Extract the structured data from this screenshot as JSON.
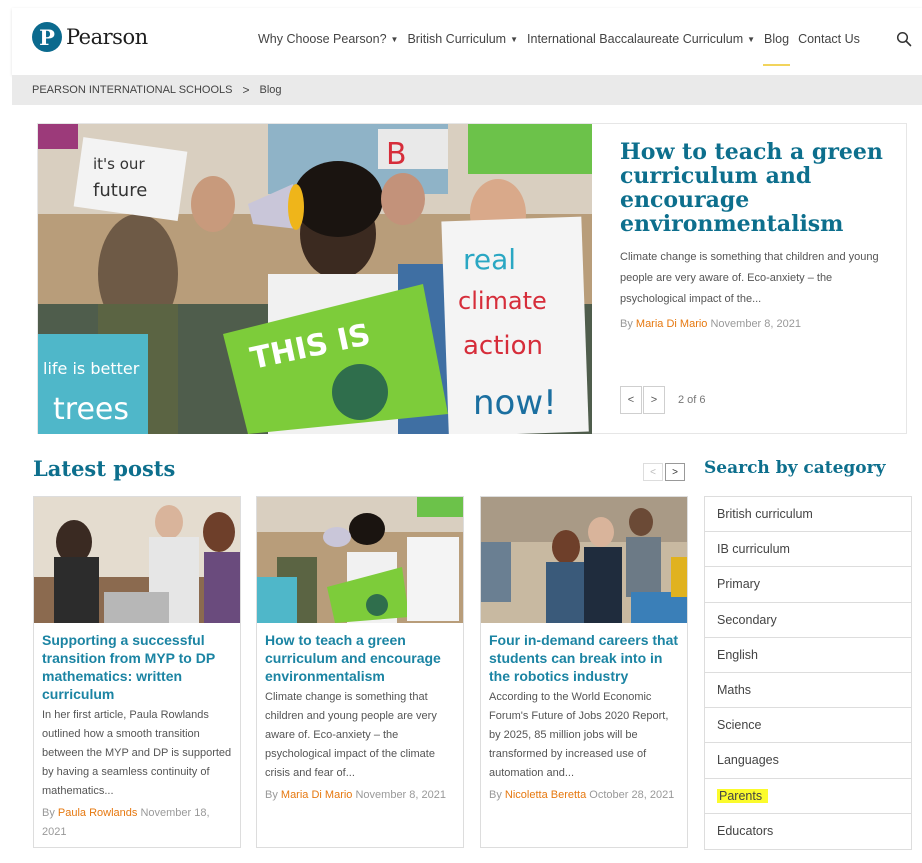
{
  "brand": {
    "logo_letter": "P",
    "name": "Pearson",
    "color": "#0b6a8e"
  },
  "nav": {
    "items": [
      {
        "label": "Why Choose Pearson?",
        "has_caret": true
      },
      {
        "label": "British Curriculum",
        "has_caret": true
      },
      {
        "label": "International Baccalaureate Curriculum",
        "has_caret": true
      },
      {
        "label": "Blog",
        "has_caret": false,
        "active": true
      },
      {
        "label": "Contact Us",
        "has_caret": false
      }
    ],
    "search_icon": "search-icon"
  },
  "breadcrumb": {
    "home": "PEARSON INTERNATIONAL SCHOOLS",
    "separator": ">",
    "current": "Blog"
  },
  "featured": {
    "title": "How to teach a green curriculum and encourage environmentalism",
    "excerpt": "Climate change is something that children and young people are very aware of. Eco-anxiety – the psychological impact of the...",
    "by": "By",
    "author": "Maria Di Mario",
    "date": "November 8, 2021",
    "pager": {
      "prev": "<",
      "next": ">",
      "count": "2 of 6"
    },
    "signs": {
      "s1": "real",
      "s2": "climate",
      "s3": "action",
      "s4": "now!",
      "s5": "THIS IS",
      "s6": "life is better",
      "s7": "trees",
      "s8": "it's our",
      "s9": "future",
      "s10": "B"
    }
  },
  "latest": {
    "heading": "Latest posts",
    "prev": "<",
    "next": ">",
    "posts": [
      {
        "title": "Supporting a successful transition from MYP to DP mathematics: written curriculum",
        "excerpt": "In her first article, Paula Rowlands outlined how a smooth transition between the MYP and DP is supported by having a seamless continuity of mathematics...",
        "by": "By",
        "author": "Paula Rowlands",
        "date": "November 18, 2021"
      },
      {
        "title": "How to teach a green curriculum and encourage environmentalism",
        "excerpt": "Climate change is something that children and young people are very aware of. Eco-anxiety – the psychological impact of the climate crisis and fear of...",
        "by": "By",
        "author": "Maria Di Mario",
        "date": "November 8, 2021"
      },
      {
        "title": "Four in-demand careers that students can break into in the robotics industry",
        "excerpt": "According to the World Economic Forum's Future of Jobs 2020 Report, by 2025, 85 million jobs will be transformed by increased use of automation and...",
        "by": "By",
        "author": "Nicoletta Beretta",
        "date": "October 28, 2021"
      }
    ]
  },
  "categories": {
    "heading": "Search by category",
    "items": [
      "British curriculum",
      "IB curriculum",
      "Primary",
      "Secondary",
      "English",
      "Maths",
      "Science",
      "Languages",
      "Parents",
      "Educators"
    ],
    "highlighted": "Parents"
  },
  "colors": {
    "title": "#0d6f8d",
    "link": "#1b84a3",
    "author": "#e6780f",
    "highlight": "#fbfb2c"
  }
}
